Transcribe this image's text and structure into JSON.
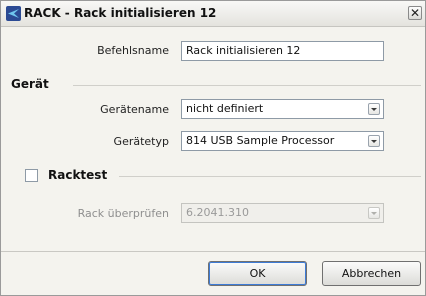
{
  "window": {
    "title": "RACK - Rack initialisieren 12",
    "close_glyph": "✕"
  },
  "form": {
    "befehlsname_label": "Befehlsname",
    "befehlsname_value": "Rack initialisieren 12"
  },
  "geraet": {
    "section_title": "Gerät",
    "geraetename_label": "Gerätename",
    "geraetename_value": "nicht definiert",
    "geraetetyp_label": "Gerätetyp",
    "geraetetyp_value": "814 USB Sample Processor"
  },
  "racktest": {
    "section_title": "Racktest",
    "checked": false,
    "rack_pruefen_label": "Rack überprüfen",
    "rack_pruefen_value": "6.2041.310"
  },
  "buttons": {
    "ok_label": "OK",
    "cancel_label": "Abbrechen"
  },
  "colors": {
    "icon_bg": "#2b4a93",
    "icon_fg": "#6fc6ee",
    "dialog_bg": "#f4f3ee"
  },
  "icons": {
    "app": "rack-app-icon",
    "close": "close-icon",
    "dropdown": "chevron-down-icon"
  }
}
